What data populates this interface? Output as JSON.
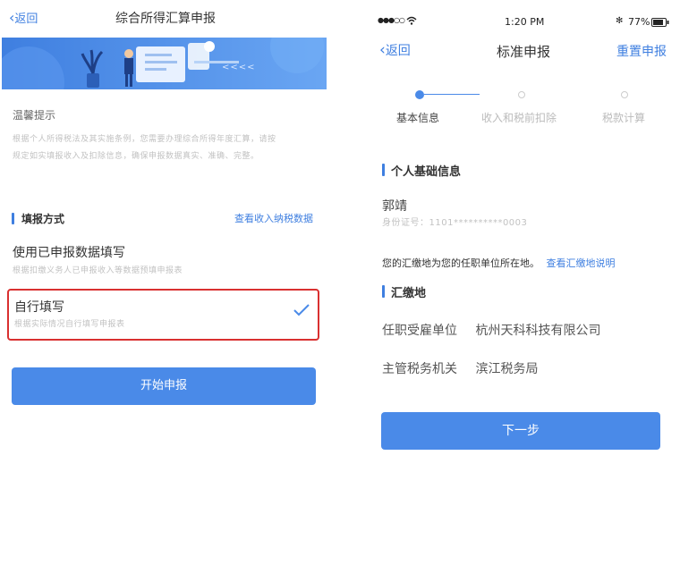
{
  "left": {
    "back_label": "返回",
    "title": "综合所得汇算申报",
    "banner_arrows": "<<<<",
    "notice_heading": "温馨提示",
    "notice_line1": "根据个人所得税法及其实施条例，您需要办理综合所得年度汇算，请按",
    "notice_line2": "规定如实填报收入及扣除信息，确保申报数据真实、准确、完整。",
    "fill_method_heading": "填报方式",
    "view_income_link": "查看收入纳税数据",
    "options": [
      {
        "title": "使用已申报数据填写",
        "desc": "根据扣缴义务人已申报收入等数据预填申报表",
        "selected": false
      },
      {
        "title": "自行填写",
        "desc": "根据实际情况自行填写申报表",
        "selected": true
      }
    ],
    "start_button": "开始申报"
  },
  "right": {
    "status": {
      "carrier": "●●●○○",
      "time": "1:20 PM",
      "bluetooth": "✻",
      "battery": "77%"
    },
    "back_label": "返回",
    "title": "标准申报",
    "reset_label": "重置申报",
    "steps": [
      {
        "label": "基本信息",
        "active": true
      },
      {
        "label": "收入和税前扣除",
        "active": false
      },
      {
        "label": "税款计算",
        "active": false
      }
    ],
    "personal_heading": "个人基础信息",
    "name": "郭靖",
    "id_label": "身份证号：",
    "id_value": "1101**********0003",
    "payment_note": "您的汇缴地为您的任职单位所在地。",
    "payment_note_link": "查看汇缴地说明",
    "payment_heading": "汇缴地",
    "employer_label": "任职受雇单位",
    "employer_value": "杭州天科科技有限公司",
    "tax_office_label": "主管税务机关",
    "tax_office_value": "滨江税务局",
    "next_button": "下一步"
  },
  "colors": {
    "accent": "#4a8ae8",
    "highlight_border": "#d93030",
    "banner": "#4a8ae8"
  }
}
